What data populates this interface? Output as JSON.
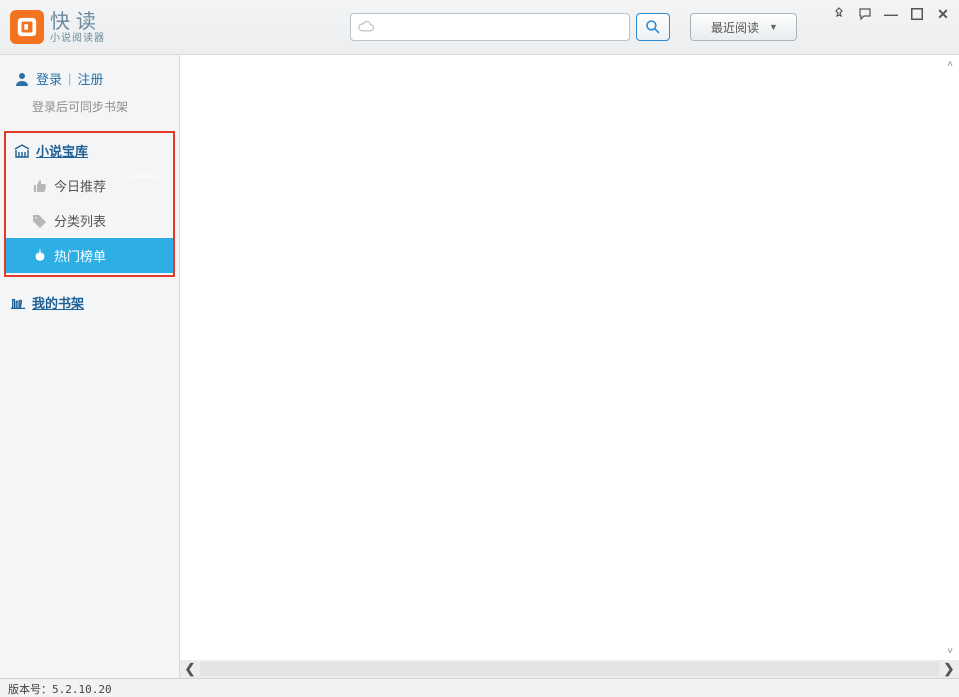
{
  "app": {
    "name_big": "快读",
    "name_small": "小说阅读器"
  },
  "toolbar": {
    "search_placeholder": "",
    "search_value": "",
    "recent_label": "最近阅读"
  },
  "auth": {
    "login_label": "登录",
    "register_label": "注册",
    "sync_tip": "登录后可同步书架"
  },
  "sidebar": {
    "library_label": "小说宝库",
    "items": [
      {
        "id": "today",
        "label": "今日推荐",
        "selected": false
      },
      {
        "id": "category",
        "label": "分类列表",
        "selected": false
      },
      {
        "id": "hot",
        "label": "热门榜单",
        "selected": true
      }
    ],
    "shelf_label": "我的书架"
  },
  "status": {
    "version_prefix": "版本号：",
    "version": "5.2.10.20"
  }
}
